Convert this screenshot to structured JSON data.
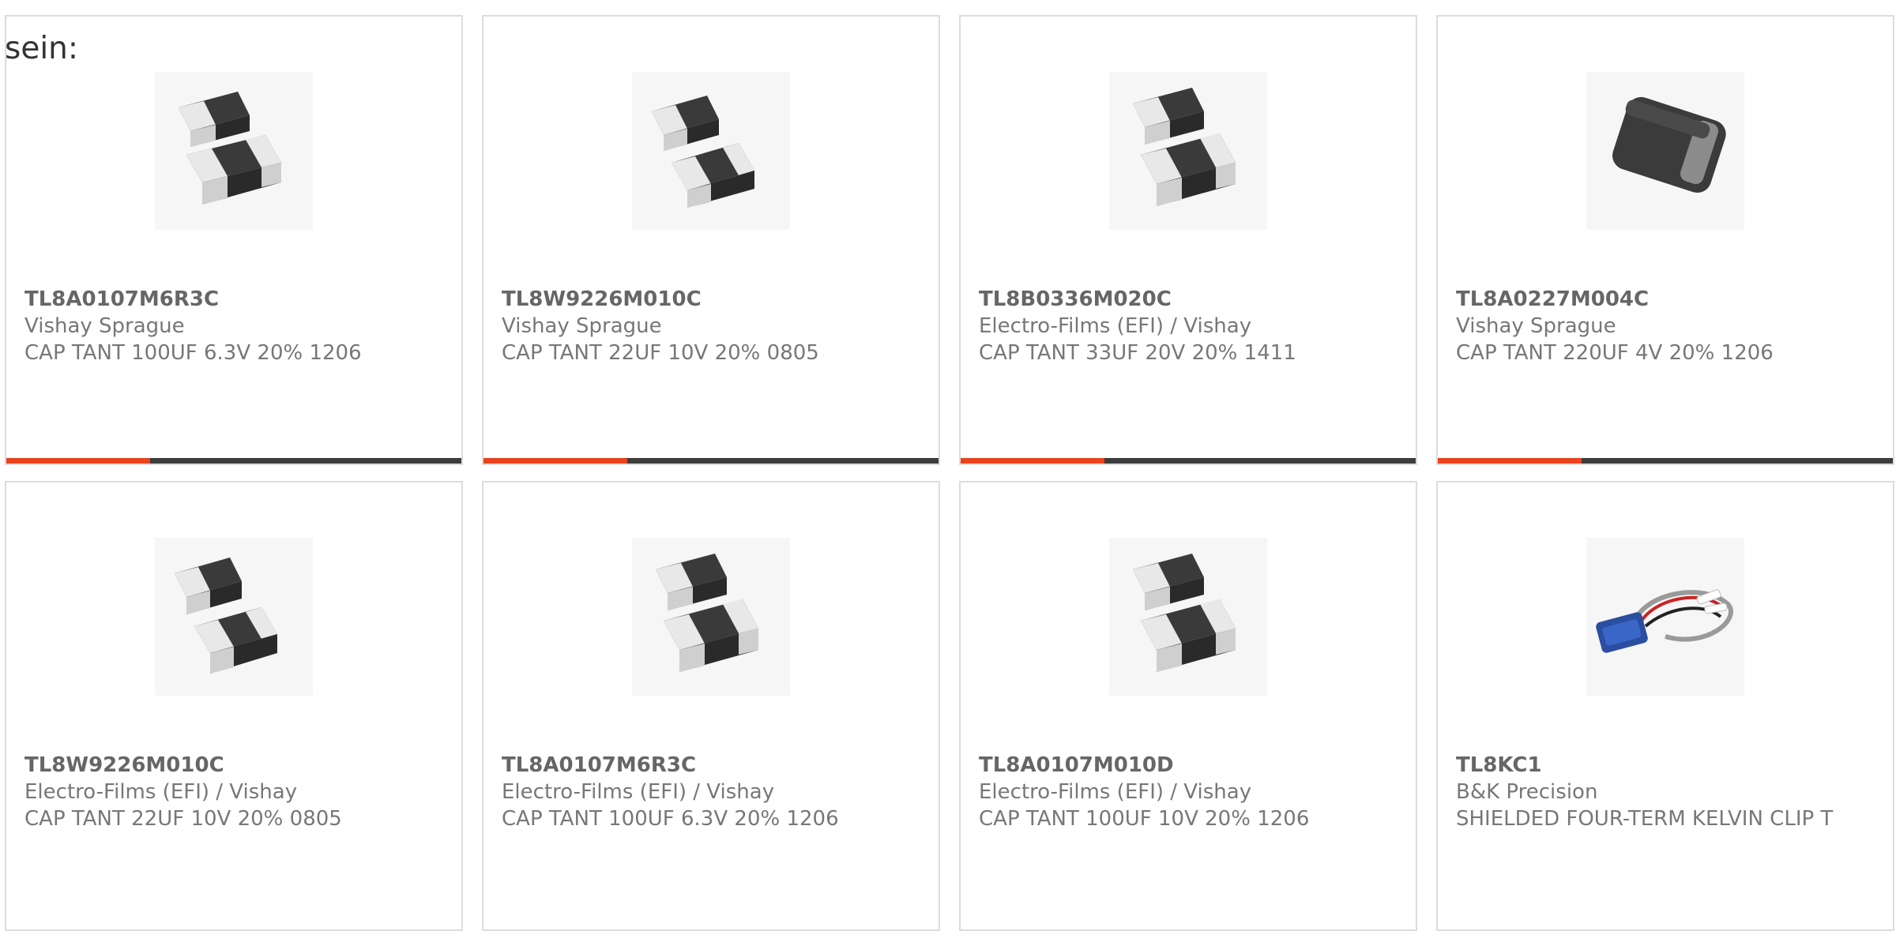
{
  "intro_text": "sein:",
  "colors": {
    "accent": "#e8441f",
    "bar_dark": "#3d3d3d",
    "card_border": "#dcdcdc"
  },
  "products": [
    {
      "part": "TL8A0107M6R3C",
      "manufacturer": "Vishay Sprague",
      "description": "CAP TANT 100UF 6.3V 20% 1206",
      "image": "smd-tantalum-capacitor-pair",
      "progress_bar": true
    },
    {
      "part": "TL8W9226M010C",
      "manufacturer": "Vishay Sprague",
      "description": "CAP TANT 22UF 10V 20% 0805",
      "image": "smd-tantalum-capacitor-pair",
      "progress_bar": true
    },
    {
      "part": "TL8B0336M020C",
      "manufacturer": "Electro-Films (EFI) / Vishay",
      "description": "CAP TANT 33UF 20V 20% 1411",
      "image": "smd-tantalum-capacitor-pair",
      "progress_bar": true
    },
    {
      "part": "TL8A0227M004C",
      "manufacturer": "Vishay Sprague",
      "description": "CAP TANT 220UF 4V 20% 1206",
      "image": "smd-molded-capacitor",
      "progress_bar": true
    },
    {
      "part": "TL8W9226M010C",
      "manufacturer": "Electro-Films (EFI) / Vishay",
      "description": "CAP TANT 22UF 10V 20% 0805",
      "image": "smd-tantalum-capacitor-pair",
      "progress_bar": false
    },
    {
      "part": "TL8A0107M6R3C",
      "manufacturer": "Electro-Films (EFI) / Vishay",
      "description": "CAP TANT 100UF 6.3V 20% 1206",
      "image": "smd-tantalum-capacitor-pair",
      "progress_bar": false
    },
    {
      "part": "TL8A0107M010D",
      "manufacturer": "Electro-Films (EFI) / Vishay",
      "description": "CAP TANT 100UF 10V 20% 1206",
      "image": "smd-tantalum-capacitor-pair",
      "progress_bar": false
    },
    {
      "part": "TL8KC1",
      "manufacturer": "B&K Precision",
      "description": "SHIELDED FOUR-TERM KELVIN CLIP T",
      "image": "kelvin-clip-cable",
      "progress_bar": false
    }
  ]
}
